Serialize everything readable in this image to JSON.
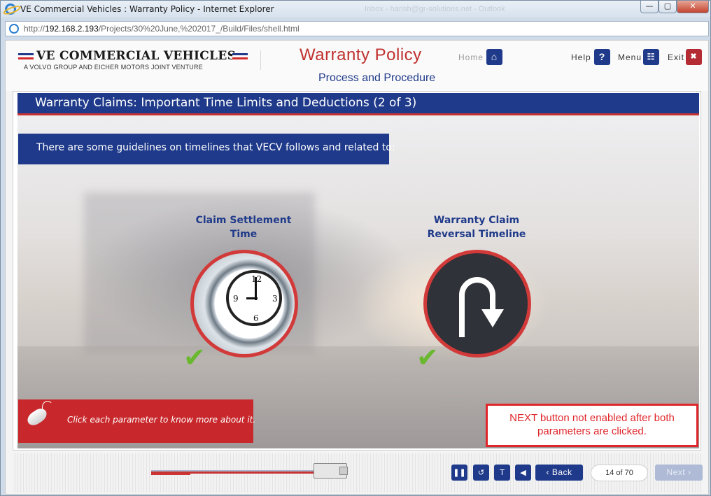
{
  "window": {
    "title": "VE Commercial Vehicles : Warranty Policy - Internet Explorer",
    "background_blur_text": "Inbox - harish@gr-solutions.net - Outlook",
    "url_prefix": "http://",
    "url_host": "192.168.2.193",
    "url_path": "/Projects/30%20June,%202017_/Build/Files/shell.html",
    "min_label": "—",
    "max_label": "▢",
    "close_label": "✕"
  },
  "header": {
    "brand_name": "VE COMMERCIAL VEHICLES",
    "brand_subtitle": "A VOLVO GROUP AND EICHER MOTORS JOINT VENTURE",
    "course_title": "Warranty Policy",
    "course_subtitle": "Process and Procedure",
    "home_label": "Home",
    "help_label": "Help",
    "menu_label": "Menu",
    "exit_label": "Exit",
    "home_icon": "⌂",
    "help_icon": "?",
    "menu_icon": "☷",
    "exit_icon": "✖"
  },
  "slide": {
    "title": "Warranty Claims: Important Time Limits and Deductions (2 of 3)",
    "intro": "There are some guidelines on timelines that VECV follows and related to:",
    "params": [
      {
        "label_line1": "Claim Settlement",
        "label_line2": "Time",
        "checked": true
      },
      {
        "label_line1": "Warranty Claim",
        "label_line2": "Reversal Timeline",
        "checked": true
      }
    ],
    "hint": "Click each parameter to know more about it.",
    "note_line1": "NEXT button not enabled after both",
    "note_line2": "parameters are clicked.",
    "check_glyph": "✔"
  },
  "footer": {
    "progress_fraction": 0.2,
    "pause_icon": "❚❚",
    "replay_icon": "↺",
    "text_icon": "T",
    "audio_icon": "◀",
    "back_label": "‹ Back",
    "page_counter": "14 of 70",
    "next_label": "Next ›",
    "next_enabled": false
  },
  "colors": {
    "brand_blue": "#1f3a8a",
    "brand_red": "#c83232",
    "check_green": "#6ab82e"
  }
}
